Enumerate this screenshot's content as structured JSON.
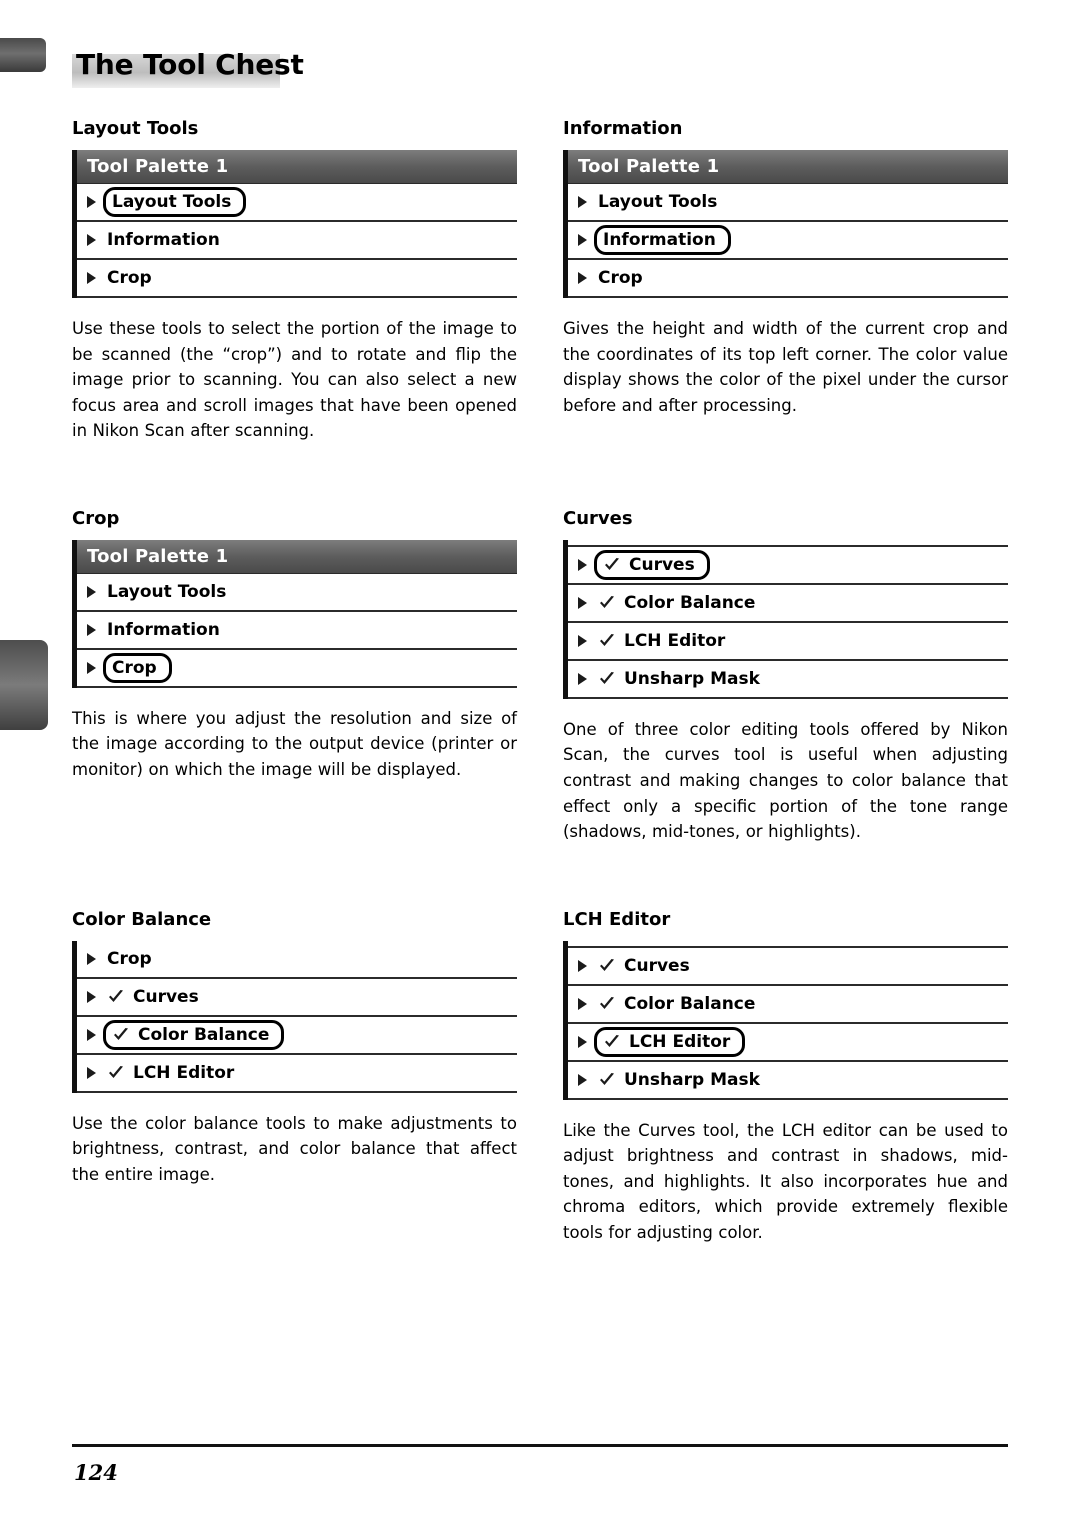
{
  "page": {
    "title": "The Tool Chest",
    "folio": "124"
  },
  "sections": [
    {
      "heading": "Layout Tools",
      "palette": {
        "has_title": true,
        "title": "Tool Palette 1",
        "sliver": false,
        "rows": [
          {
            "label": "Layout Tools",
            "selected": true,
            "check": false
          },
          {
            "label": "Information",
            "selected": false,
            "check": false
          },
          {
            "label": "Crop",
            "selected": false,
            "check": false
          }
        ]
      },
      "body": "Use these tools to select the portion of the image to be scanned (the “crop”) and to rotate and flip the image prior to scanning.  You can also select a new focus area and scroll images that have been opened in Nikon Scan after scanning."
    },
    {
      "heading": "Information",
      "palette": {
        "has_title": true,
        "title": "Tool Palette 1",
        "sliver": false,
        "rows": [
          {
            "label": "Layout Tools",
            "selected": false,
            "check": false
          },
          {
            "label": "Information",
            "selected": true,
            "check": false
          },
          {
            "label": "Crop",
            "selected": false,
            "check": false
          }
        ]
      },
      "body": "Gives the height and width of the current crop and the coordinates of its top left corner.  The color value display shows the color of the pixel under the cursor before and after processing."
    },
    {
      "heading": "Crop",
      "palette": {
        "has_title": true,
        "title": "Tool Palette 1",
        "sliver": false,
        "rows": [
          {
            "label": "Layout Tools",
            "selected": false,
            "check": false
          },
          {
            "label": "Information",
            "selected": false,
            "check": false
          },
          {
            "label": "Crop",
            "selected": true,
            "check": false
          }
        ]
      },
      "body": "This is where you adjust the resolution and size of the image according to the output device (printer or monitor) on which the image will be displayed."
    },
    {
      "heading": "Curves",
      "palette": {
        "has_title": false,
        "title": "",
        "sliver": true,
        "rows": [
          {
            "label": "Curves",
            "selected": true,
            "check": true
          },
          {
            "label": "Color Balance",
            "selected": false,
            "check": true
          },
          {
            "label": "LCH Editor",
            "selected": false,
            "check": true
          },
          {
            "label": "Unsharp Mask",
            "selected": false,
            "check": true
          }
        ]
      },
      "body": "One of three color editing tools offered by Nikon Scan, the curves tool is useful when adjusting contrast and making changes to color balance that effect only a specific portion of the tone range (shadows, mid-tones, or highlights)."
    },
    {
      "heading": "Color Balance",
      "palette": {
        "has_title": false,
        "title": "",
        "sliver": false,
        "rows": [
          {
            "label": "Crop",
            "selected": false,
            "check": false
          },
          {
            "label": "Curves",
            "selected": false,
            "check": true
          },
          {
            "label": "Color Balance",
            "selected": true,
            "check": true
          },
          {
            "label": "LCH Editor",
            "selected": false,
            "check": true
          }
        ]
      },
      "body": "Use the color balance tools to make adjustments to brightness, contrast, and color balance that affect the entire image."
    },
    {
      "heading": "LCH Editor",
      "palette": {
        "has_title": false,
        "title": "",
        "sliver": true,
        "rows": [
          {
            "label": "Curves",
            "selected": false,
            "check": true
          },
          {
            "label": "Color Balance",
            "selected": false,
            "check": true
          },
          {
            "label": "LCH Editor",
            "selected": true,
            "check": true
          },
          {
            "label": "Unsharp Mask",
            "selected": false,
            "check": true
          }
        ]
      },
      "body": "Like the Curves tool, the LCH editor can be used to adjust brightness and contrast in shadows, mid-tones, and highlights.  It also incorporates hue and chroma editors, which provide extremely flexible tools for adjusting color."
    }
  ]
}
